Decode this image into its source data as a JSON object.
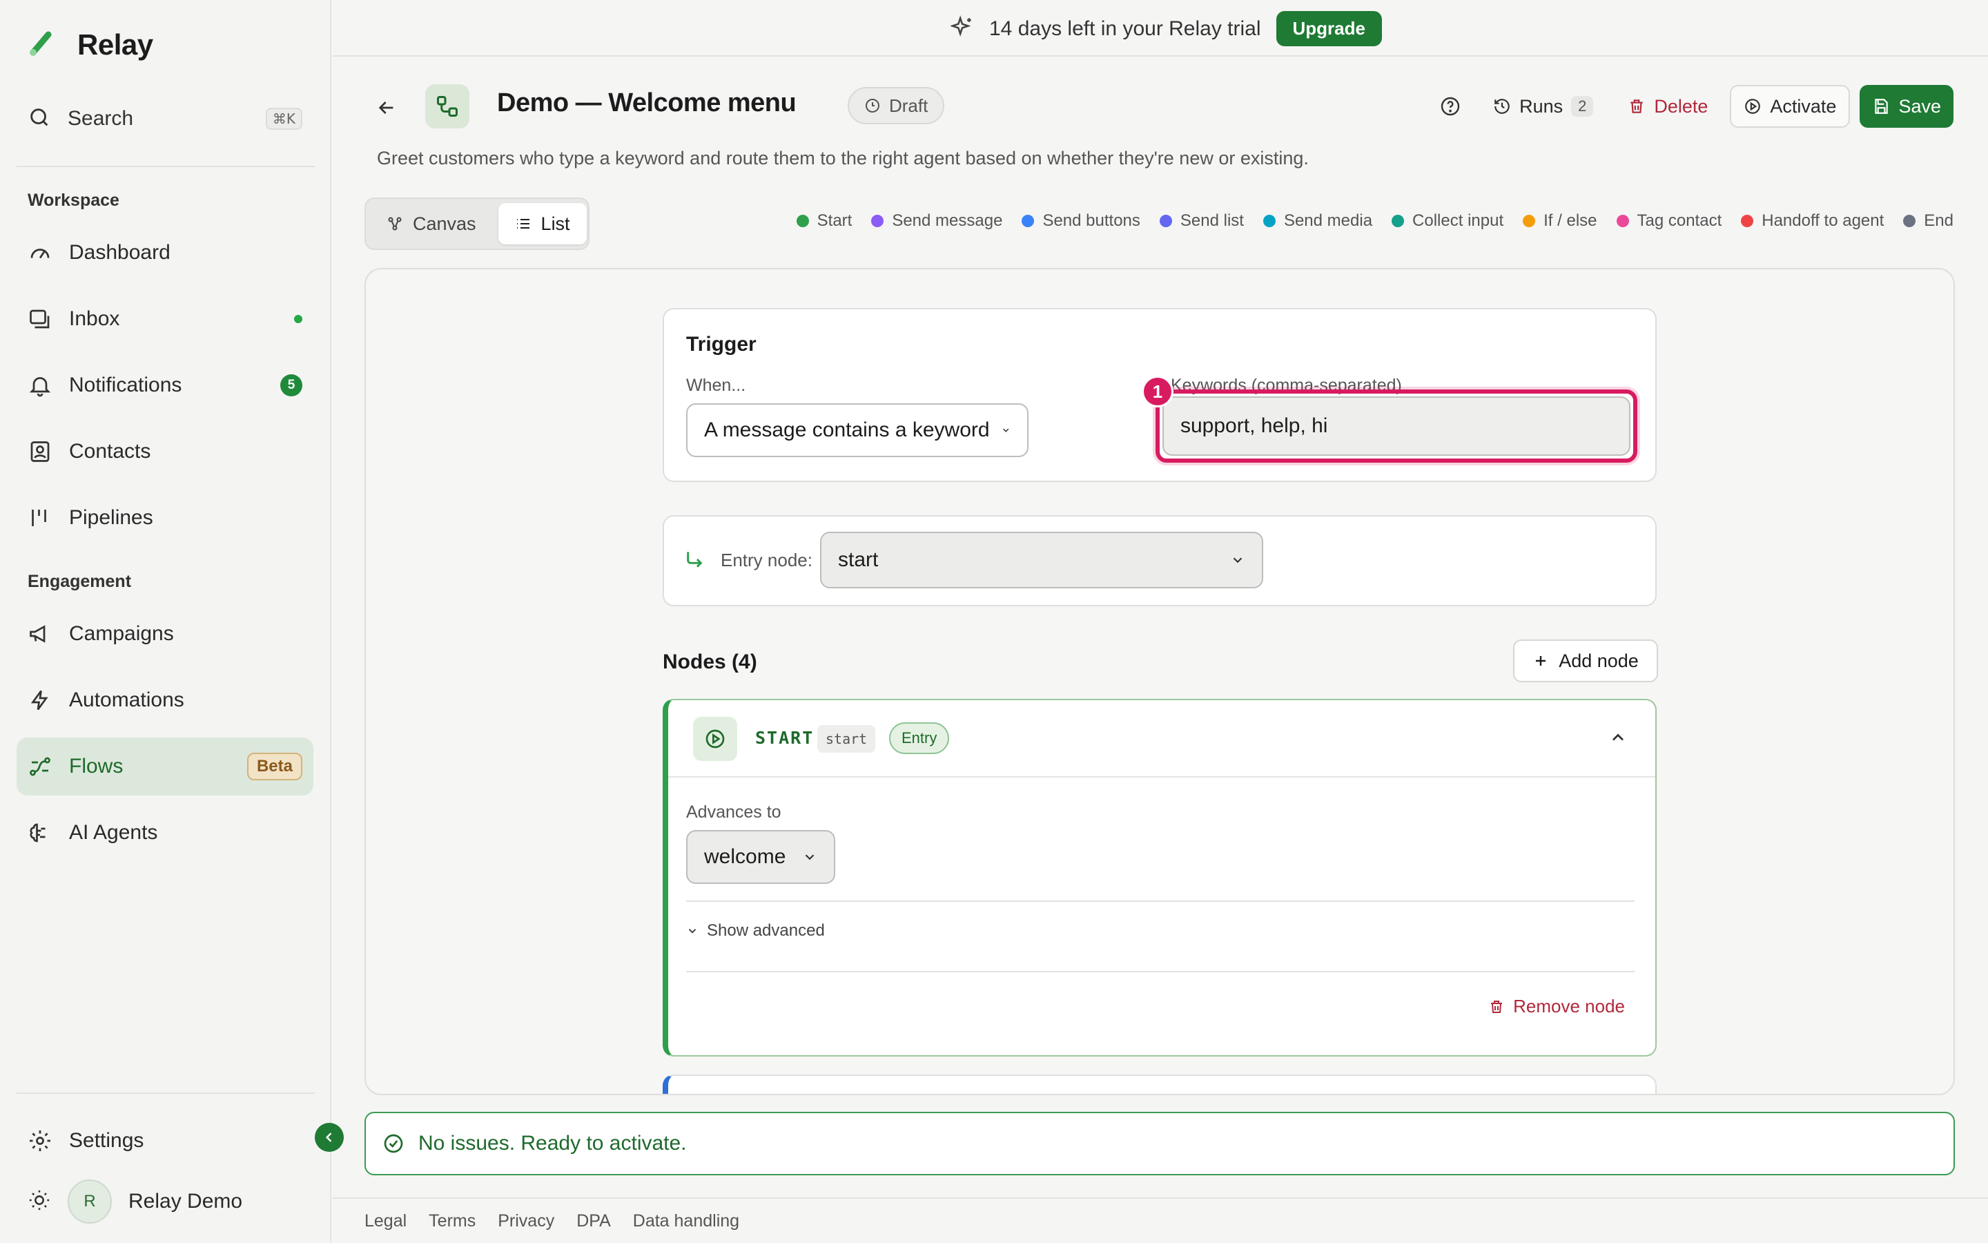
{
  "brand": {
    "name": "Relay",
    "accent": "#1f7a34"
  },
  "sidebar": {
    "search": {
      "label": "Search",
      "shortcut": "⌘K"
    },
    "sections": {
      "workspace": "Workspace",
      "engagement": "Engagement"
    },
    "items": [
      {
        "label": "Dashboard",
        "icon": "gauge-icon"
      },
      {
        "label": "Inbox",
        "icon": "inbox-icon"
      },
      {
        "label": "Notifications",
        "icon": "bell-icon",
        "badge": "5"
      },
      {
        "label": "Contacts",
        "icon": "contacts-icon"
      },
      {
        "label": "Pipelines",
        "icon": "pipeline-icon"
      },
      {
        "label": "Campaigns",
        "icon": "megaphone-icon"
      },
      {
        "label": "Automations",
        "icon": "bolt-icon"
      },
      {
        "label": "Flows",
        "icon": "flow-icon",
        "badge": "Beta",
        "active": true
      },
      {
        "label": "AI Agents",
        "icon": "brain-icon"
      }
    ],
    "settings": "Settings",
    "user": {
      "initial": "R",
      "name": "Relay Demo"
    }
  },
  "banner": {
    "text": "14 days left in your Relay trial",
    "button": "Upgrade"
  },
  "header": {
    "title": "Demo — Welcome menu",
    "status": "Draft",
    "description": "Greet customers who type a keyword and route them to the right agent based on whether they're new or existing.",
    "runs_label": "Runs",
    "runs_count": "2",
    "delete": "Delete",
    "activate": "Activate",
    "save": "Save"
  },
  "view_toggle": {
    "canvas": "Canvas",
    "list": "List",
    "active": "List"
  },
  "legend": [
    {
      "label": "Start",
      "color": "#2e9f4a"
    },
    {
      "label": "Send message",
      "color": "#8b5cf6"
    },
    {
      "label": "Send buttons",
      "color": "#3b82f6"
    },
    {
      "label": "Send list",
      "color": "#6366f1"
    },
    {
      "label": "Send media",
      "color": "#06a3c4"
    },
    {
      "label": "Collect input",
      "color": "#14a08a"
    },
    {
      "label": "If / else",
      "color": "#f59e0b"
    },
    {
      "label": "Tag contact",
      "color": "#ec4899"
    },
    {
      "label": "Handoff to agent",
      "color": "#ef4444"
    },
    {
      "label": "End",
      "color": "#6b7280"
    }
  ],
  "trigger": {
    "title": "Trigger",
    "when_label": "When...",
    "when_value": "A message contains a keyword",
    "keywords_label": "Keywords (comma-separated)",
    "keywords_value": "support, help, hi",
    "marker": "1"
  },
  "entry": {
    "label": "Entry node:",
    "value": "start"
  },
  "nodes": {
    "title": "Nodes (4)",
    "add_button": "Add node",
    "items": [
      {
        "type": "START",
        "id": "start",
        "badge": "Entry",
        "advances_label": "Advances to",
        "advances_value": "welcome",
        "show_advanced": "Show advanced",
        "remove": "Remove node"
      }
    ]
  },
  "status": {
    "text": "No issues. Ready to activate."
  },
  "footer": {
    "links": [
      "Legal",
      "Terms",
      "Privacy",
      "DPA",
      "Data handling"
    ]
  }
}
